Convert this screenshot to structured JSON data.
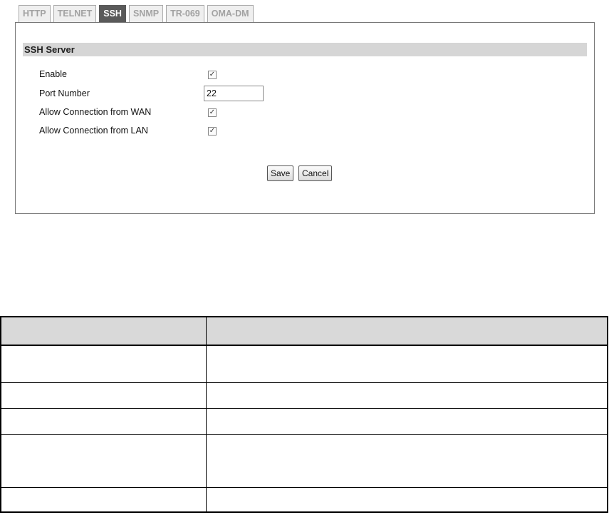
{
  "tabs": [
    "HTTP",
    "TELNET",
    "SSH",
    "SNMP",
    "TR-069",
    "OMA-DM"
  ],
  "active_tab": "SSH",
  "section": {
    "title": "SSH Server"
  },
  "form": {
    "enable_label": "Enable",
    "enable_checked": true,
    "port_label": "Port Number",
    "port_value": "22",
    "wan_label": "Allow Connection from WAN",
    "wan_checked": true,
    "lan_label": "Allow Connection from LAN",
    "lan_checked": true
  },
  "buttons": {
    "save": "Save",
    "cancel": "Cancel"
  },
  "table": {
    "headers": [
      "",
      ""
    ],
    "rows": [
      [
        "",
        ""
      ],
      [
        "",
        ""
      ],
      [
        "",
        ""
      ],
      [
        "",
        ""
      ],
      [
        "",
        ""
      ]
    ]
  }
}
